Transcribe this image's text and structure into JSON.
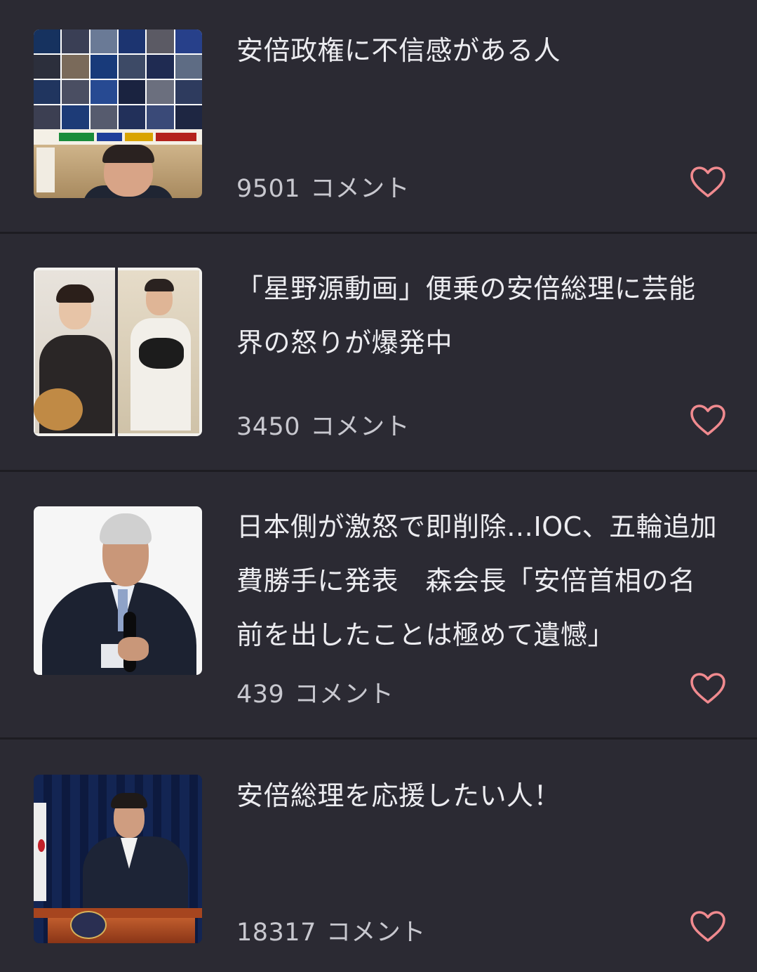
{
  "feed": {
    "items": [
      {
        "title": "安倍政権に不信感がある人",
        "comment_count": "9501",
        "comment_unit": "コメント",
        "thumbnail": "news-collage-thumbnail"
      },
      {
        "title": "「星野源動画」便乗の安倍総理に芸能界の怒りが爆発中",
        "comment_count": "3450",
        "comment_unit": "コメント",
        "thumbnail": "split-video-thumbnail"
      },
      {
        "title": "日本側が激怒で即削除…IOC、五輪追加費勝手に発表　森会長「安倍首相の名前を出したことは極めて遺憾」",
        "comment_count": "439",
        "comment_unit": "コメント",
        "thumbnail": "speaker-thumbnail"
      },
      {
        "title": "安倍総理を応援したい人！",
        "comment_count": "18317",
        "comment_unit": "コメント",
        "thumbnail": "podium-thumbnail"
      }
    ],
    "heart_icon": "heart-outline-icon"
  },
  "colors": {
    "background": "#2b2a33",
    "divider": "#1d1c22",
    "heart": "#f08a8f",
    "title_text": "#ececf0",
    "meta_text": "#c8c8cf"
  }
}
